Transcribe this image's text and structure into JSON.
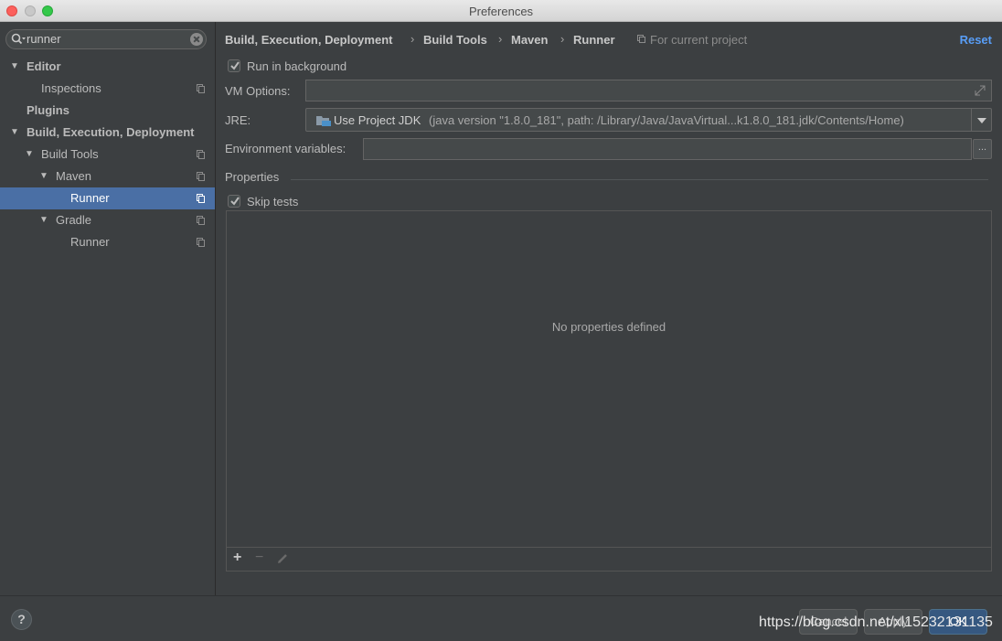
{
  "window": {
    "title": "Preferences"
  },
  "sidebar": {
    "search": {
      "value": "runner"
    },
    "items": [
      {
        "label": "Editor",
        "bold": true,
        "expanded": true
      },
      {
        "label": "Inspections",
        "bold": false
      },
      {
        "label": "Plugins",
        "bold": true
      },
      {
        "label": "Build, Execution, Deployment",
        "bold": true,
        "expanded": true
      },
      {
        "label": "Build Tools",
        "bold": false,
        "expanded": true
      },
      {
        "label": "Maven",
        "bold": false,
        "expanded": true
      },
      {
        "label": "Runner",
        "bold": false,
        "selected": true
      },
      {
        "label": "Gradle",
        "bold": false,
        "expanded": true
      },
      {
        "label": "Runner",
        "bold": false
      }
    ]
  },
  "breadcrumb": {
    "items": [
      "Build, Execution, Deployment",
      "Build Tools",
      "Maven",
      "Runner"
    ],
    "separator": "›",
    "scope": "For current project",
    "reset_label": "Reset"
  },
  "settings": {
    "run_in_background": {
      "label": "Run in background",
      "checked": true
    },
    "vm_options": {
      "label": "VM Options:",
      "value": ""
    },
    "jre": {
      "label": "JRE:",
      "selected": "Use Project JDK",
      "detail": "(java version \"1.8.0_181\", path: /Library/Java/JavaVirtual...k1.8.0_181.jdk/Contents/Home)"
    },
    "env_vars": {
      "label": "Environment variables:",
      "value": "",
      "browse_label": "..."
    },
    "properties": {
      "title": "Properties",
      "skip_tests": {
        "label": "Skip tests",
        "checked": true
      },
      "empty_text": "No properties defined",
      "toolbar": {
        "add": "+",
        "remove": "−"
      }
    }
  },
  "footer": {
    "help": "?",
    "cancel": "Cancel",
    "apply": "Apply",
    "ok": "OK",
    "watermark": "https://blog.csdn.net/xl15232131135"
  },
  "colors": {
    "accent": "#4a6fa5",
    "link": "#589df6",
    "background": "#3c3f41",
    "ok_button": "#365880"
  }
}
